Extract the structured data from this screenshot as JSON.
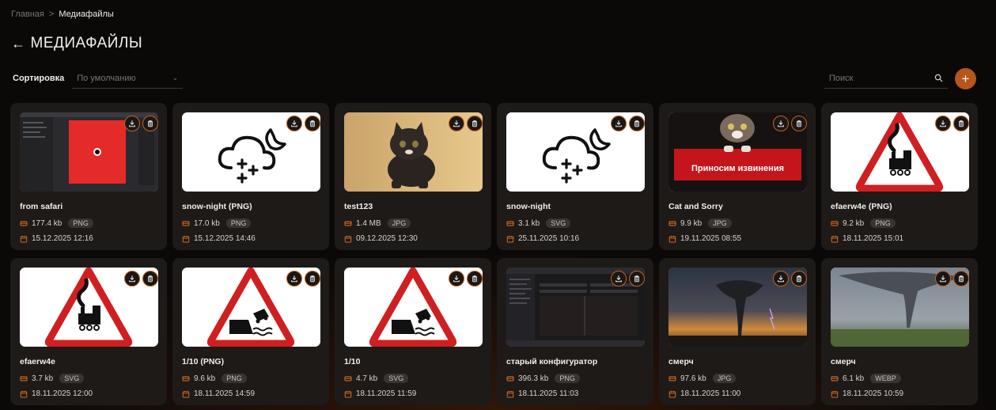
{
  "breadcrumb": {
    "home": "Главная",
    "separator": ">",
    "current": "Медиафайлы"
  },
  "page": {
    "back_icon": "arrow-left-icon",
    "title": "МЕДИАФАЙЛЫ"
  },
  "sort": {
    "label": "Сортировка",
    "value": "По умолчанию",
    "icon": "chevron-down-icon"
  },
  "search": {
    "placeholder": "Поиск",
    "icon": "search-icon"
  },
  "add_button": {
    "label": "+",
    "color": "#b5561a"
  },
  "colors": {
    "accent": "#c4621f",
    "card": "#1e1a18",
    "background": "#0b0908"
  },
  "files": [
    {
      "name": "from safari",
      "size": "177.4 kb",
      "type": "PNG",
      "date": "15.12.2025 12:16",
      "thumb": "screenshot-red"
    },
    {
      "name": "snow-night (PNG)",
      "size": "17.0 kb",
      "type": "PNG",
      "date": "15.12.2025 14:46",
      "thumb": "snow-night"
    },
    {
      "name": "test123",
      "size": "1.4 MB",
      "type": "JPG",
      "date": "09.12.2025 12:30",
      "thumb": "kitten"
    },
    {
      "name": "snow-night",
      "size": "3.1 kb",
      "type": "SVG",
      "date": "25.11.2025 10:16",
      "thumb": "snow-night"
    },
    {
      "name": "Cat and Sorry",
      "size": "9.9 kb",
      "type": "JPG",
      "date": "19.11.2025 08:55",
      "thumb": "cat-sorry",
      "thumb_text": "Приносим извинения"
    },
    {
      "name": "efaerw4e (PNG)",
      "size": "9.2 kb",
      "type": "PNG",
      "date": "18.11.2025 15:01",
      "thumb": "train-sign"
    },
    {
      "name": "efaerw4e",
      "size": "3.7 kb",
      "type": "SVG",
      "date": "18.11.2025 12:00",
      "thumb": "train-sign"
    },
    {
      "name": "1/10 (PNG)",
      "size": "9.6 kb",
      "type": "PNG",
      "date": "18.11.2025 14:59",
      "thumb": "quay-sign"
    },
    {
      "name": "1/10",
      "size": "4.7 kb",
      "type": "SVG",
      "date": "18.11.2025 11:59",
      "thumb": "quay-sign"
    },
    {
      "name": "старый конфигуратор",
      "size": "396.3 kb",
      "type": "PNG",
      "date": "18.11.2025 11:03",
      "thumb": "dark-screenshot"
    },
    {
      "name": "смерч",
      "size": "97.6 kb",
      "type": "JPG",
      "date": "18.11.2025 11:00",
      "thumb": "tornado-sunset"
    },
    {
      "name": "смерч",
      "size": "6.1 kb",
      "type": "WEBP",
      "date": "18.11.2025 10:59",
      "thumb": "tornado-field"
    }
  ]
}
